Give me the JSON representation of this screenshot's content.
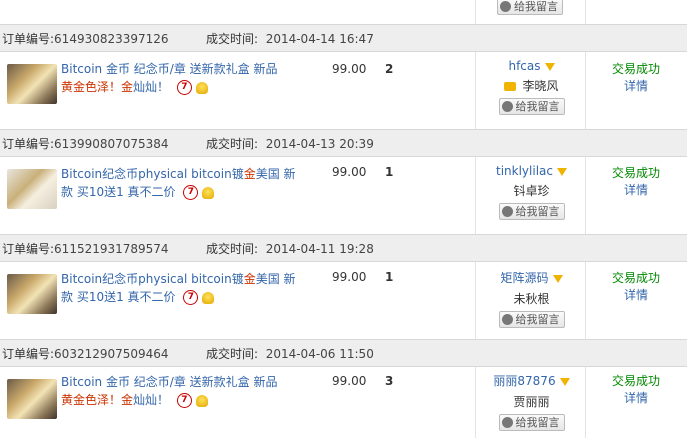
{
  "labels": {
    "order_number": "订单编号:",
    "deal_time": "成交时间:",
    "leave_message": "给我留言",
    "status_success": "交易成功",
    "details": "详情"
  },
  "orders": [
    {
      "order_no": "614930823397126",
      "time": "2014-04-14 16:47",
      "title_pre": "Bitcoin 金币 纪念币/章 送新款礼盒 新品",
      "title_line2_gold": "黄金色泽",
      "title_line2_mid": "！",
      "title_line2_gold2": "金",
      "title_line2_end": "灿灿！",
      "price": "99.00",
      "qty": "2",
      "buyer_nick": "hfcas",
      "buyer_name": "李晓风"
    },
    {
      "order_no": "613990807075384",
      "time": "2014-04-13 20:39",
      "title_a": "Bitcoin纪念币physical bitcoin镀",
      "title_gold": "金",
      "title_b": "美国 新款 买10送1 真不二价",
      "price": "99.00",
      "qty": "1",
      "buyer_nick": "tinklylilac",
      "buyer_name": "钭卓珍"
    },
    {
      "order_no": "611521931789574",
      "time": "2014-04-11 19:28",
      "title_a": "Bitcoin纪念币physical bitcoin镀",
      "title_gold": "金",
      "title_b": "美国 新款 买10送1 真不二价",
      "price": "99.00",
      "qty": "1",
      "buyer_nick": "矩阵源码",
      "buyer_name": "未秋根"
    },
    {
      "order_no": "603212907509464",
      "time": "2014-04-06 11:50",
      "title_pre": "Bitcoin 金币 纪念币/章 送新款礼盒 新品",
      "title_line2_gold": "黄金色泽",
      "title_line2_mid": "！",
      "title_line2_gold2": "金",
      "title_line2_end": "灿灿！",
      "price": "99.00",
      "qty": "3",
      "buyer_nick": "丽丽87876",
      "buyer_name": "贾丽丽"
    }
  ]
}
